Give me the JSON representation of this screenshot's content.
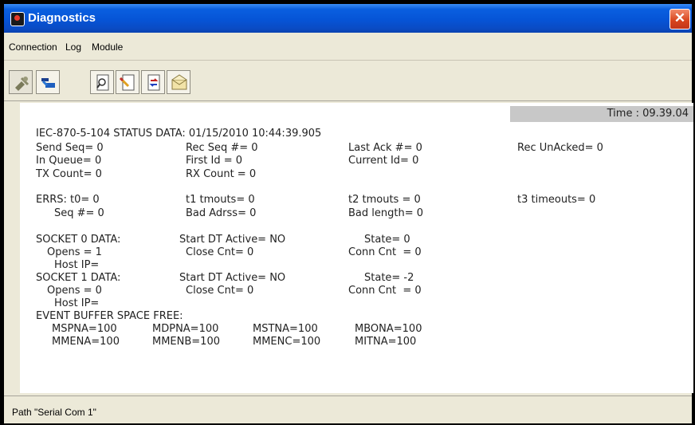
{
  "window": {
    "title": "Diagnostics",
    "close_glyph": "✕"
  },
  "menu": [
    "Connection",
    "Log",
    "Module"
  ],
  "toolbar": {
    "icons": [
      "disconnect-icon",
      "connect-icon",
      "search-page-icon",
      "edit-page-icon",
      "transfer-page-icon",
      "mail-icon"
    ]
  },
  "time": "Time : 09.39.04",
  "status": {
    "header": "IEC-870-5-104 STATUS DATA: 01/15/2010 10:44:39.905",
    "send_seq": "Send Seq= 0",
    "rec_seq": "Rec Seq #= 0",
    "last_ack": "Last Ack #= 0",
    "rec_unacked": "Rec UnAcked= 0",
    "in_queue": "In Queue= 0",
    "first_id": "First Id = 0",
    "current_id": "Current Id= 0",
    "tx_count": "TX Count= 0",
    "rx_count": "RX Count = 0",
    "errs_t0": "ERRS: t0= 0",
    "t1_tmouts": "t1 tmouts= 0",
    "t2_tmouts": "t2 tmouts = 0",
    "t3_timeouts": "t3 timeouts= 0",
    "seq_num": "Seq #= 0",
    "bad_adrss": "Bad Adrss= 0",
    "bad_length": "Bad length= 0"
  },
  "sockets": [
    {
      "label": "SOCKET 0 DATA:",
      "start_dt": "Start DT Active= NO",
      "state": "State= 0",
      "opens": "Opens = 1",
      "close_cnt": "Close Cnt= 0",
      "conn_cnt": "Conn Cnt  = 0",
      "host_ip": "Host IP="
    },
    {
      "label": "SOCKET 1 DATA:",
      "start_dt": "Start DT Active= NO",
      "state": "State= -2",
      "opens": "Opens = 0",
      "close_cnt": "Close Cnt= 0",
      "conn_cnt": "Conn Cnt  = 0",
      "host_ip": "Host IP="
    }
  ],
  "event_buffer": {
    "header": "EVENT BUFFER SPACE FREE:",
    "row1": [
      "MSPNA=100",
      "MDPNA=100",
      "MSTNA=100",
      "MBONA=100"
    ],
    "row2": [
      "MMENA=100",
      "MMENB=100",
      "MMENC=100",
      "MITNA=100"
    ]
  },
  "statusbar": "Path \"Serial Com 1\""
}
